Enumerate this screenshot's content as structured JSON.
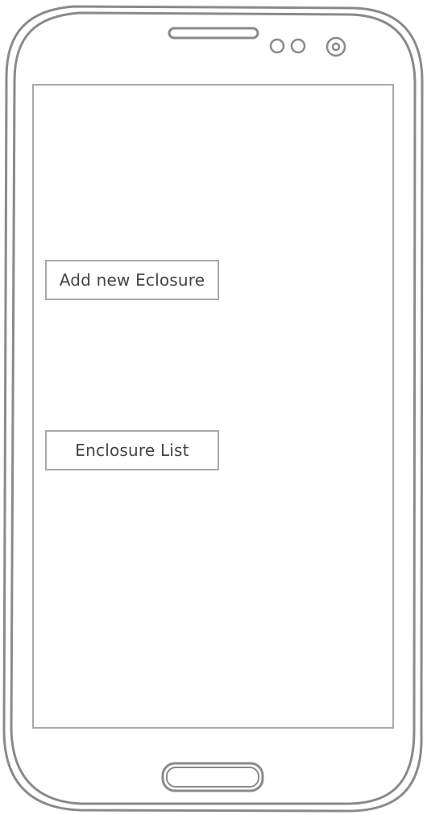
{
  "screen": {
    "buttons": [
      {
        "label": "Add new Eclosure"
      },
      {
        "label": "Enclosure List"
      }
    ]
  },
  "icons": {
    "speaker": "speaker-grille-icon",
    "sensors": "sensor-icon",
    "camera": "front-camera-icon",
    "home": "home-button-icon"
  }
}
